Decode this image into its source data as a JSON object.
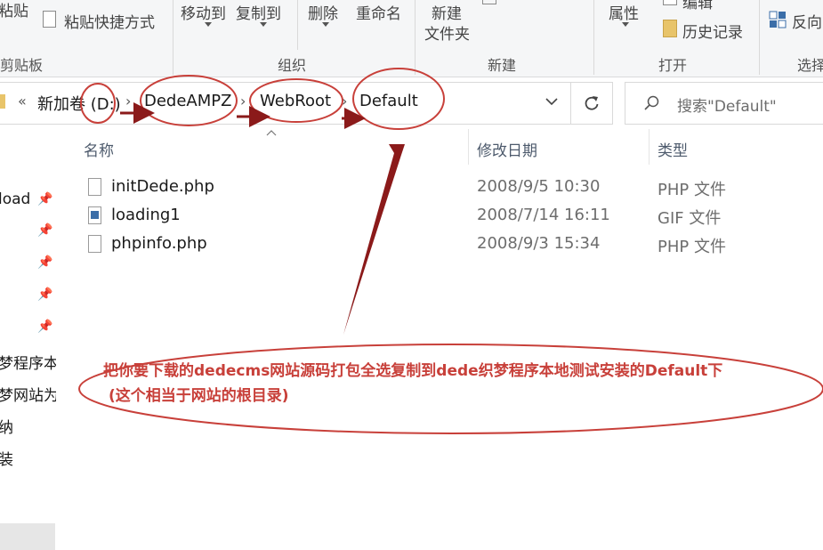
{
  "ribbon": {
    "clipboard": {
      "paste_label": "粘贴",
      "paste_shortcut_label": "粘贴快捷方式",
      "group_label": "剪贴板"
    },
    "organize": {
      "move_to_label": "移动到",
      "copy_to_label": "复制到",
      "delete_label": "删除",
      "rename_label": "重命名",
      "group_label": "组织"
    },
    "new": {
      "new_folder_label_line1": "新建",
      "new_folder_label_line2": "文件夹",
      "group_label": "新建"
    },
    "open": {
      "properties_label": "属性",
      "edit_label": "编辑",
      "history_label": "历史记录",
      "group_label": "打开"
    },
    "select": {
      "invert_label": "反向",
      "group_label": "选择"
    }
  },
  "address": {
    "overflow_marker": "«",
    "crumbs": [
      "新加卷 (D:)",
      "DedeAMPZ",
      "WebRoot",
      "Default"
    ],
    "search_placeholder": "搜索\"Default\""
  },
  "nav": {
    "items": [
      "load",
      "",
      "",
      "",
      "",
      "梦程序本",
      "梦网站为",
      "纳",
      "装"
    ]
  },
  "columns": {
    "name": "名称",
    "date": "修改日期",
    "type": "类型"
  },
  "files": [
    {
      "name": "initDede.php",
      "date": "2008/9/5 10:30",
      "type": "PHP 文件",
      "icon": "php-file-icon"
    },
    {
      "name": "loading1",
      "date": "2008/7/14 16:11",
      "type": "GIF 文件",
      "icon": "gif-image-icon"
    },
    {
      "name": "phpinfo.php",
      "date": "2008/9/3 15:34",
      "type": "PHP 文件",
      "icon": "php-file-icon"
    }
  ],
  "annotation": {
    "line1": "把你要下载的dedecms网站源码打包全选复制到dede织梦程序本地测试安装的Default下",
    "line2": "(这个相当于网站的根目录)",
    "color": "#c8403a"
  }
}
